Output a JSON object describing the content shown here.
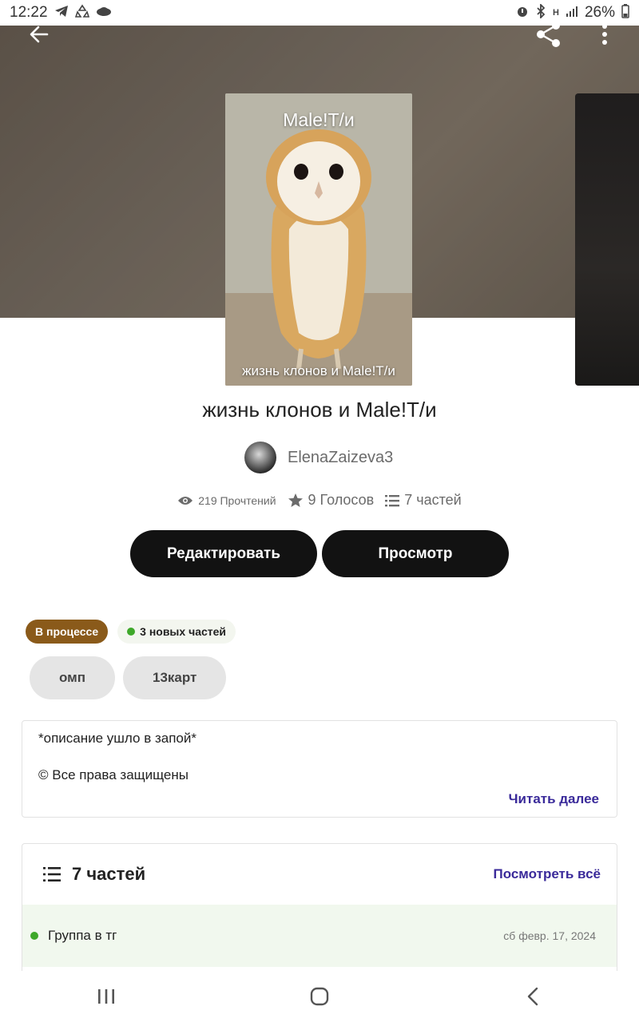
{
  "status_bar": {
    "time": "12:22",
    "battery": "26%",
    "left_icons": [
      "telegram-icon",
      "recycle-icon",
      "cloud-icon"
    ],
    "right_icons": [
      "alarm-icon",
      "bluetooth-icon",
      "network-h-icon",
      "signal-icon"
    ]
  },
  "header": {
    "back_icon": "arrow-left-icon",
    "share_icon": "share-icon",
    "more_icon": "more-vertical-icon"
  },
  "cover": {
    "top_text": "Male!Т/и",
    "bottom_text": "жизнь клонов и Male!Т/и"
  },
  "story": {
    "title": "жизнь клонов и Male!Т/и",
    "author": "ElenaZaizeva3",
    "reads": "219 Прочтений",
    "votes": "9 Голосов",
    "parts": "7 частей"
  },
  "actions": {
    "edit_label": "Редактировать",
    "preview_label": "Просмотр"
  },
  "badges": {
    "status": "В процессе",
    "new_parts": "3 новых частей",
    "accent_status": "#8a5a1a",
    "accent_new": "#3ea82a"
  },
  "tags": [
    "омп",
    "13карт"
  ],
  "description": {
    "line1": "*описание ушло в запой*",
    "line2": "© Все права защищены",
    "read_more": "Читать далее"
  },
  "parts_section": {
    "title": "7 частей",
    "view_all": "Посмотреть всё",
    "items": [
      {
        "title": "Группа в тг",
        "date": "сб февр. 17, 2024"
      }
    ]
  },
  "navbar": {
    "icons": [
      "recent-apps-icon",
      "home-icon",
      "back-icon"
    ]
  }
}
